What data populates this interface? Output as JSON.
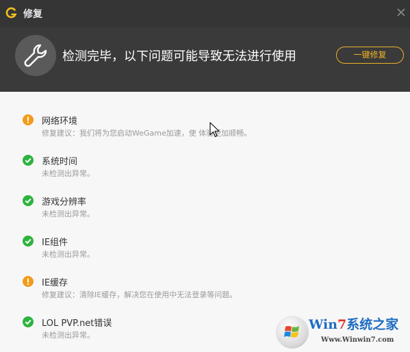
{
  "window": {
    "title": "修复",
    "logo_icon": "wegame-logo-icon",
    "close_icon": "close-icon"
  },
  "banner": {
    "icon": "wrench-icon",
    "headline": "检测完毕，以下问题可能导致无法进行使用",
    "fix_button": "一键修复"
  },
  "items": [
    {
      "status": "warning",
      "name": "网络环境",
      "desc": "修复建议：我们将为您启动WeGame加速，使  体验更加顺畅。"
    },
    {
      "status": "ok",
      "name": "系统时间",
      "desc": "未检测出异常。"
    },
    {
      "status": "ok",
      "name": "游戏分辨率",
      "desc": "未检测出异常。"
    },
    {
      "status": "ok",
      "name": "IE组件",
      "desc": "未检测出异常。"
    },
    {
      "status": "warning",
      "name": "IE缓存",
      "desc": "修复建议：清除IE缓存，解决您在使用中无法登录等问题。"
    },
    {
      "status": "ok",
      "name": "LOL PVP.net错误",
      "desc": "未检测出异常。"
    }
  ],
  "watermark": {
    "title_prefix": "Win",
    "title_accent": "7",
    "title_suffix": "系统之家",
    "url": "Www.Winwin7.com"
  },
  "colors": {
    "ok": "#2eb33f",
    "warning": "#f39b1a",
    "accent": "#f0b22b"
  }
}
